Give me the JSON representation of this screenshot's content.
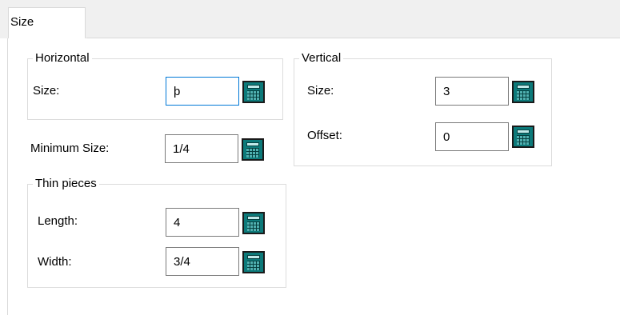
{
  "tab": {
    "label": "Size"
  },
  "horizontal": {
    "title": "Horizontal",
    "size_label": "Size:",
    "size_value": "þ"
  },
  "minimum": {
    "label": "Minimum Size:",
    "value": "1/4"
  },
  "thin": {
    "title": "Thin pieces",
    "length_label": "Length:",
    "length_value": "4",
    "width_label": "Width:",
    "width_value": "3/4"
  },
  "vertical": {
    "title": "Vertical",
    "size_label": "Size:",
    "size_value": "3",
    "offset_label": "Offset:",
    "offset_value": "0"
  },
  "icons": {
    "calculator": "calculator-icon"
  },
  "colors": {
    "focus_border": "#0078d7",
    "calculator": "#0c7a7a"
  }
}
